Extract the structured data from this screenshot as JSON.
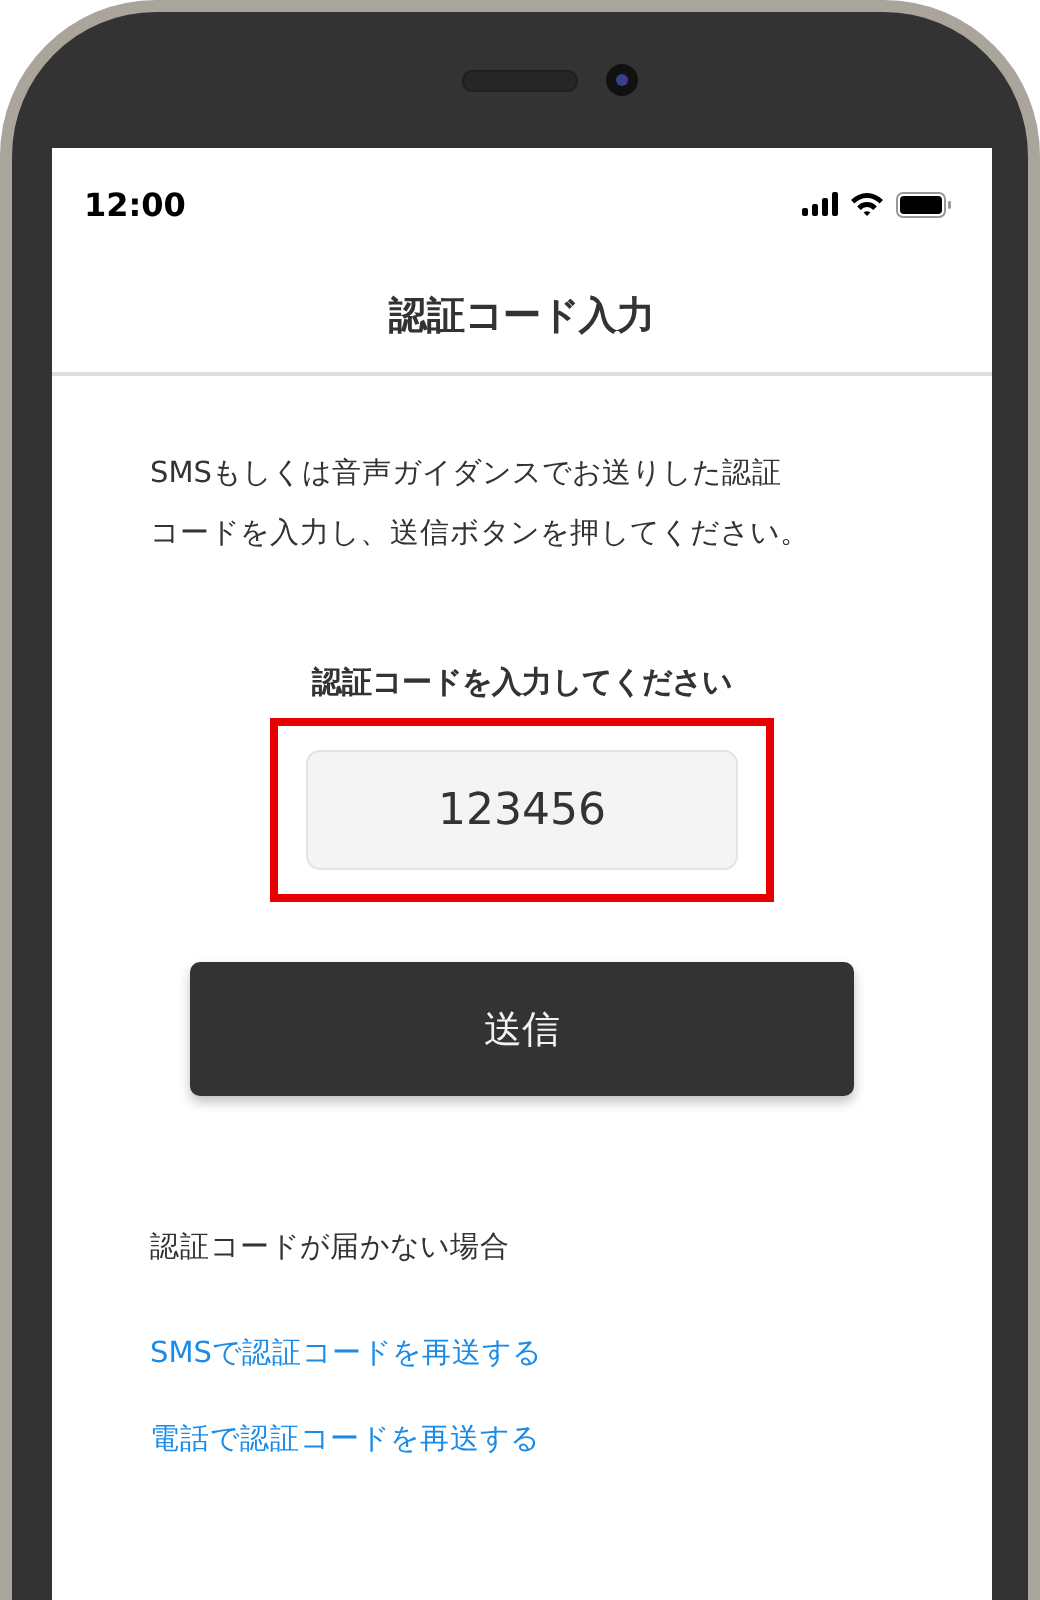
{
  "status_bar": {
    "time": "12:00"
  },
  "header": {
    "title": "認証コード入力"
  },
  "instructions": [
    "SMSもしくは音声ガイダンスでお送りした認証",
    "コードを入力し、送信ボタンを押してください。"
  ],
  "code_field": {
    "label": "認証コードを入力してください",
    "value": "123456",
    "highlighted": true
  },
  "submit_button": {
    "label": "送信"
  },
  "help": {
    "heading": "認証コードが届かない場合",
    "links": [
      "SMSで認証コードを再送する",
      "電話で認証コードを再送する"
    ]
  }
}
